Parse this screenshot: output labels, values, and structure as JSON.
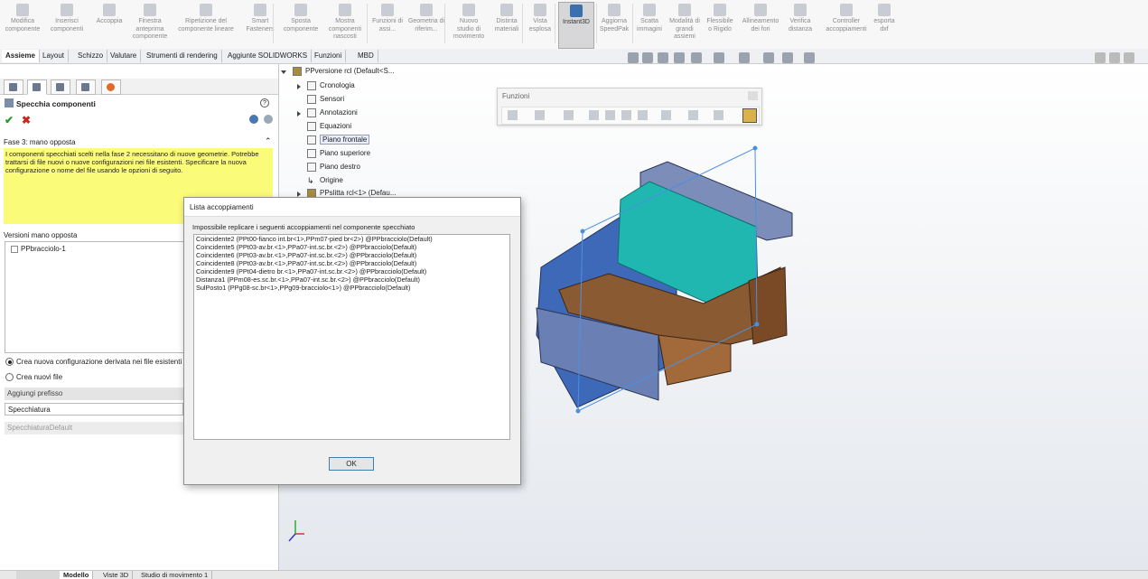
{
  "ribbon": {
    "buttons": [
      {
        "label": "Modifica componente",
        "icon": "edit-component-icon"
      },
      {
        "label": "Inserisci componenti",
        "icon": "insert-components-icon"
      },
      {
        "label": "Accoppia",
        "icon": "mate-icon"
      },
      {
        "label": "Finestra anteprima componente",
        "icon": "preview-window-icon"
      },
      {
        "label": "Ripetizione del componente lineare",
        "icon": "linear-pattern-icon"
      },
      {
        "label": "Smart Fasteners",
        "icon": "smart-fasteners-icon"
      },
      {
        "label": "Sposta componente",
        "icon": "move-component-icon"
      },
      {
        "label": "Mostra componenti nascosti",
        "icon": "show-hidden-icon"
      },
      {
        "label": "Funzioni di assi...",
        "icon": "assembly-features-icon"
      },
      {
        "label": "Geometria di riferim...",
        "icon": "reference-geometry-icon"
      },
      {
        "label": "Nuovo studio di movimento",
        "icon": "motion-study-icon"
      },
      {
        "label": "Distinta materiali",
        "icon": "bom-icon"
      },
      {
        "label": "Vista esplosa",
        "icon": "exploded-view-icon"
      },
      {
        "label": "Instant3D",
        "icon": "instant3d-icon"
      },
      {
        "label": "Aggiorna SpeedPak",
        "icon": "speedpak-icon"
      },
      {
        "label": "Scatta immagini",
        "icon": "snapshot-icon"
      },
      {
        "label": "Modalità di grandi assiemi",
        "icon": "large-assembly-icon"
      },
      {
        "label": "Flessibile o Rigido",
        "icon": "flexible-rigid-icon"
      },
      {
        "label": "Allineamento dei fori",
        "icon": "hole-alignment-icon"
      },
      {
        "label": "Verifica distanza",
        "icon": "clearance-icon"
      },
      {
        "label": "Controller accoppiamenti",
        "icon": "mate-controller-icon"
      },
      {
        "label": "esporta dxf",
        "icon": "export-dxf-icon"
      }
    ]
  },
  "command_tabs": [
    "Assieme",
    "Layout",
    "Schizzo",
    "Valutare",
    "Strumenti di rendering",
    "Aggiunte SOLIDWORKS",
    "Funzioni",
    "MBD"
  ],
  "property_manager": {
    "title": "Specchia componenti",
    "phase_label": "Fase 3: mano opposta",
    "message": "I componenti specchiati scelti nella fase 2 necessitano di nuove geometrie. Potrebbe trattarsi di file nuovi o nuove configurazioni nei file esistenti. Specificare la nuova configurazione o nome del file usando le opzioni di seguito.",
    "versions_label": "Versioni mano opposta",
    "versions_items": [
      "PPbracciolo-1"
    ],
    "radio_option_1": "Crea nuova configurazione derivata nei file esistenti",
    "radio_option_2": "Crea nuovi file",
    "prefix_label": "Aggiungi prefisso",
    "prefix_value": "Specchiatura",
    "config_value": "SpecchiaturaDefault"
  },
  "feature_tree": {
    "root": "PPversione rcl  (Default<S...",
    "items": [
      "Cronologia",
      "Sensori",
      "Annotazioni",
      "Equazioni",
      "Piano frontale",
      "Piano superiore",
      "Piano destro",
      "Origine",
      "PPslitta rcl<1> (Defau..."
    ]
  },
  "floating_toolbar": {
    "title": "Funzioni"
  },
  "dialog": {
    "title": "Lista accoppiamenti",
    "message": "Impossibile replicare i seguenti accoppiamenti nel componente specchiato",
    "items": [
      "Coincidente2 (PPt00-fianco int.br<1>,PPm07-pied br<2>)   @PPbracciolo(Default)",
      "Coincidente5 (PPt03-av.br.<1>,PPa07-int.sc.br.<2>)   @PPbracciolo(Default)",
      "Coincidente6 (PPt03-av.br.<1>,PPa07-int.sc.br.<2>)   @PPbracciolo(Default)",
      "Coincidente8 (PPt03-av.br.<1>,PPa07-int.sc.br.<2>)   @PPbracciolo(Default)",
      "Coincidente9 (PPt04-dietro br.<1>,PPa07-int.sc.br.<2>)   @PPbracciolo(Default)",
      "Distanza1 (PPm08-es.sc.br.<1>,PPa07-int.sc.br.<2>)   @PPbracciolo(Default)",
      "SulPosto1 (PPg08-sc.br<1>,PPg09-bracciolo<1>)   @PPbracciolo(Default)"
    ],
    "ok_label": "OK"
  },
  "status_tabs": [
    "Modello",
    "Viste 3D",
    "Studio di movimento 1"
  ],
  "colors": {
    "accent": "#3a6fb0",
    "message_bg": "#fbfb7a",
    "chair_blue": "#3e68b8",
    "chair_cyan": "#1fb7b0",
    "wood": "#8a5a32"
  }
}
